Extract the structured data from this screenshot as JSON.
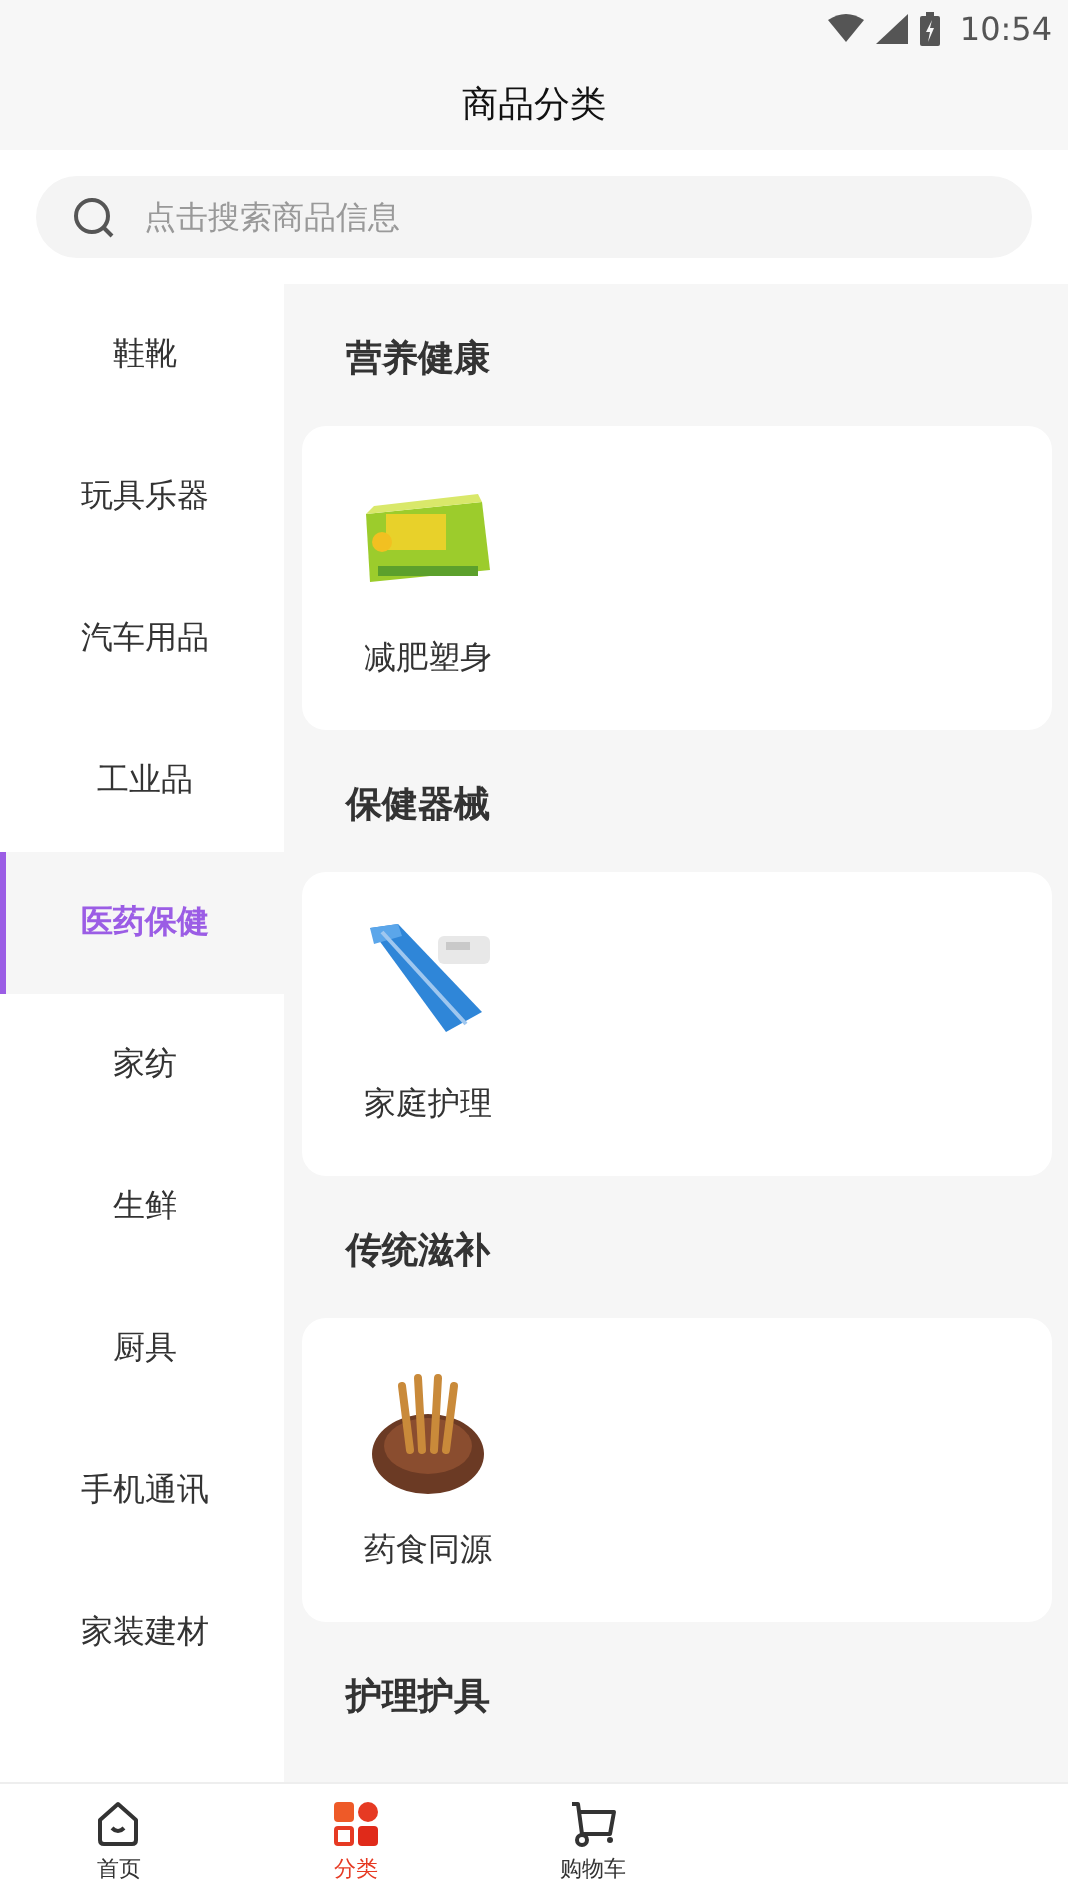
{
  "status_bar": {
    "time": "10:54"
  },
  "header": {
    "title": "商品分类"
  },
  "search": {
    "placeholder": "点击搜索商品信息"
  },
  "sidebar": {
    "items": [
      {
        "label": "鞋靴",
        "selected": false
      },
      {
        "label": "玩具乐器",
        "selected": false
      },
      {
        "label": "汽车用品",
        "selected": false
      },
      {
        "label": "工业品",
        "selected": false
      },
      {
        "label": "医药保健",
        "selected": true
      },
      {
        "label": "家纺",
        "selected": false
      },
      {
        "label": "生鲜",
        "selected": false
      },
      {
        "label": "厨具",
        "selected": false
      },
      {
        "label": "手机通讯",
        "selected": false
      },
      {
        "label": "家装建材",
        "selected": false
      }
    ]
  },
  "sections": [
    {
      "title": "营养健康",
      "items": [
        {
          "label": "减肥塑身",
          "kind": "picture"
        }
      ]
    },
    {
      "title": "保健器械",
      "items": [
        {
          "label": "家庭护理",
          "kind": "picture"
        }
      ]
    },
    {
      "title": "传统滋补",
      "items": [
        {
          "label": "药食同源",
          "kind": "picture"
        }
      ]
    },
    {
      "title": "护理护具"
    }
  ],
  "tab_bar": {
    "tabs": [
      {
        "label": "首页",
        "selected": false
      },
      {
        "label": "分类",
        "selected": true
      },
      {
        "label": "购物车",
        "selected": false
      }
    ]
  }
}
